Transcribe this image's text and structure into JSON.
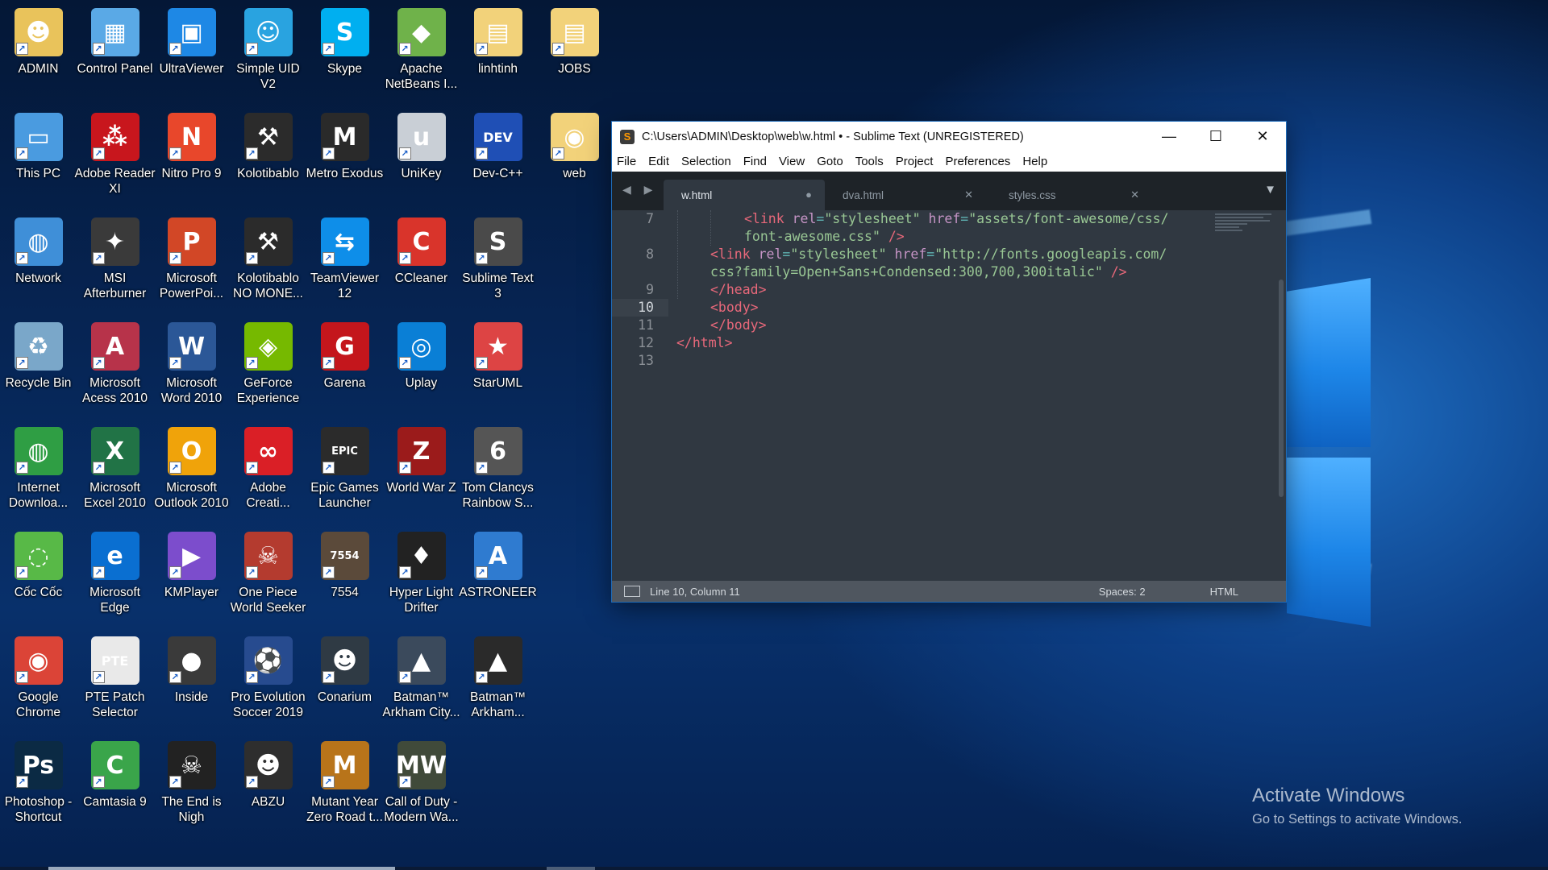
{
  "desktop": {
    "icons": [
      {
        "label": "ADMIN",
        "glyph": "☻",
        "color": "#e9c35b"
      },
      {
        "label": "Control Panel",
        "glyph": "▦",
        "color": "#5aa9e6"
      },
      {
        "label": "UltraViewer",
        "glyph": "▣",
        "color": "#1e88e5"
      },
      {
        "label": "Simple UID V2",
        "glyph": "☺",
        "color": "#29a3e0"
      },
      {
        "label": "Skype",
        "glyph": "S",
        "color": "#00aff0"
      },
      {
        "label": "Apache NetBeans I...",
        "glyph": "◆",
        "color": "#6fb24a"
      },
      {
        "label": "linhtinh",
        "glyph": "▤",
        "color": "#f2d27a"
      },
      {
        "label": "JOBS",
        "glyph": "▤",
        "color": "#f2d27a"
      },
      {
        "label": "This PC",
        "glyph": "▭",
        "color": "#4a9be0"
      },
      {
        "label": "Adobe Reader XI",
        "glyph": "⁂",
        "color": "#c8161d"
      },
      {
        "label": "Nitro Pro 9",
        "glyph": "N",
        "color": "#e8472b"
      },
      {
        "label": "Kolotibablo",
        "glyph": "⚒",
        "color": "#2b2b2b"
      },
      {
        "label": "Metro Exodus",
        "glyph": "M",
        "color": "#2a2a2a"
      },
      {
        "label": "UniKey",
        "glyph": "u",
        "color": "#c9cfd6"
      },
      {
        "label": "Dev-C++",
        "glyph": "DEV",
        "color": "#1f4fb5"
      },
      {
        "label": "web",
        "glyph": "◉",
        "color": "#f2d27a"
      },
      {
        "label": "Network",
        "glyph": "◍",
        "color": "#3f8fd8"
      },
      {
        "label": "MSI Afterburner",
        "glyph": "✦",
        "color": "#3a3a3a"
      },
      {
        "label": "Microsoft PowerPoi...",
        "glyph": "P",
        "color": "#d24726"
      },
      {
        "label": "Kolotibablo NO MONE...",
        "glyph": "⚒",
        "color": "#2b2b2b"
      },
      {
        "label": "TeamViewer 12",
        "glyph": "⇆",
        "color": "#0e8ee9"
      },
      {
        "label": "CCleaner",
        "glyph": "C",
        "color": "#d9342b"
      },
      {
        "label": "Sublime Text 3",
        "glyph": "S",
        "color": "#4a4a4a"
      },
      {
        "label": "Recycle Bin",
        "glyph": "♻",
        "color": "#7aa7c9"
      },
      {
        "label": "Microsoft Acess 2010",
        "glyph": "A",
        "color": "#b7334a"
      },
      {
        "label": "Microsoft Word 2010",
        "glyph": "W",
        "color": "#2b5797"
      },
      {
        "label": "GeForce Experience",
        "glyph": "◈",
        "color": "#76b900"
      },
      {
        "label": "Garena",
        "glyph": "G",
        "color": "#c4161c"
      },
      {
        "label": "Uplay",
        "glyph": "◎",
        "color": "#0a7fd6"
      },
      {
        "label": "StarUML",
        "glyph": "★",
        "color": "#d44"
      },
      {
        "label": "Internet Downloa...",
        "glyph": "◍",
        "color": "#2f9e44"
      },
      {
        "label": "Microsoft Excel 2010",
        "glyph": "X",
        "color": "#217346"
      },
      {
        "label": "Microsoft Outlook 2010",
        "glyph": "O",
        "color": "#f0a30a"
      },
      {
        "label": "Adobe Creati...",
        "glyph": "∞",
        "color": "#da1f26"
      },
      {
        "label": "Epic Games Launcher",
        "glyph": "EPIC",
        "color": "#2b2b2b"
      },
      {
        "label": "World War Z",
        "glyph": "Z",
        "color": "#9b1b1b"
      },
      {
        "label": "Tom Clancys Rainbow S...",
        "glyph": "6",
        "color": "#555"
      },
      {
        "label": "Cốc Cốc",
        "glyph": "◌",
        "color": "#58b947"
      },
      {
        "label": "Microsoft Edge",
        "glyph": "e",
        "color": "#0a6fd1"
      },
      {
        "label": "KMPlayer",
        "glyph": "▶",
        "color": "#7c4dcc"
      },
      {
        "label": "One Piece World Seeker",
        "glyph": "☠",
        "color": "#b43b2f"
      },
      {
        "label": "7554",
        "glyph": "7554",
        "color": "#5b4a3a"
      },
      {
        "label": "Hyper Light Drifter",
        "glyph": "♦",
        "color": "#222"
      },
      {
        "label": "ASTRONEER",
        "glyph": "A",
        "color": "#2f7bd0"
      },
      {
        "label": "Google Chrome",
        "glyph": "◉",
        "color": "#db4437"
      },
      {
        "label": "PTE Patch Selector",
        "glyph": "PTE",
        "color": "#e9e9e9"
      },
      {
        "label": "Inside",
        "glyph": "●",
        "color": "#3a3a3a"
      },
      {
        "label": "Pro Evolution Soccer 2019",
        "glyph": "⚽",
        "color": "#274b8f"
      },
      {
        "label": "Conarium",
        "glyph": "☻",
        "color": "#2f3a44"
      },
      {
        "label": "Batman™ Arkham City...",
        "glyph": "▲",
        "color": "#3b4a5c"
      },
      {
        "label": "Batman™ Arkham...",
        "glyph": "▲",
        "color": "#2a2a2a"
      },
      {
        "label": "Photoshop - Shortcut",
        "glyph": "Ps",
        "color": "#0b2a44"
      },
      {
        "label": "Camtasia 9",
        "glyph": "C",
        "color": "#3aa54a"
      },
      {
        "label": "The End is Nigh",
        "glyph": "☠",
        "color": "#222"
      },
      {
        "label": "ABZU",
        "glyph": "☻",
        "color": "#2e2e2e"
      },
      {
        "label": "Mutant Year Zero Road t...",
        "glyph": "M",
        "color": "#b8741a"
      },
      {
        "label": "Call of Duty - Modern Wa...",
        "glyph": "MW",
        "color": "#404a3a"
      }
    ]
  },
  "sublime": {
    "title": "C:\\Users\\ADMIN\\Desktop\\web\\w.html • - Sublime Text (UNREGISTERED)",
    "app_icon": "S",
    "window_controls": {
      "minimize": "—",
      "maximize": "☐",
      "close": "✕"
    },
    "menu": [
      "File",
      "Edit",
      "Selection",
      "Find",
      "View",
      "Goto",
      "Tools",
      "Project",
      "Preferences",
      "Help"
    ],
    "tab_nav": "◀ ▶",
    "tabs": [
      {
        "label": "w.html",
        "close": "●",
        "active": true
      },
      {
        "label": "dva.html",
        "close": "✕",
        "active": false
      },
      {
        "label": "styles.css",
        "close": "✕",
        "active": false
      }
    ],
    "tab_dropdown": "▼",
    "line_numbers": [
      "7",
      "",
      "8",
      "",
      "9",
      "10",
      "11",
      "12",
      "13"
    ],
    "code": {
      "l7a_open": "<link ",
      "l7a_rel": "rel",
      "l7a_eq1": "=",
      "l7a_relv": "\"stylesheet\"",
      "l7a_href": " href",
      "l7a_eq2": "=",
      "l7a_hrefv": "\"assets/font-awesome/css/",
      "l7b": "font-awesome.css\"",
      "l7b_close": " />",
      "l8a_open": "<link ",
      "l8a_rel": "rel",
      "l8a_eq1": "=",
      "l8a_relv": "\"stylesheet\"",
      "l8a_href": " href",
      "l8a_eq2": "=",
      "l8a_hrefv": "\"http://fonts.googleapis.com/",
      "l8b": "css?family=Open+Sans+Condensed:300,700,300italic\"",
      "l8b_close": " />",
      "l9": "</head>",
      "l10": "<body>",
      "l11": "</body>",
      "l12": "</html>"
    },
    "status": {
      "position": "Line 10, Column 11",
      "spaces": "Spaces: 2",
      "syntax": "HTML"
    }
  },
  "watermark": {
    "line1": "Activate Windows",
    "line2": "Go to Settings to activate Windows."
  }
}
